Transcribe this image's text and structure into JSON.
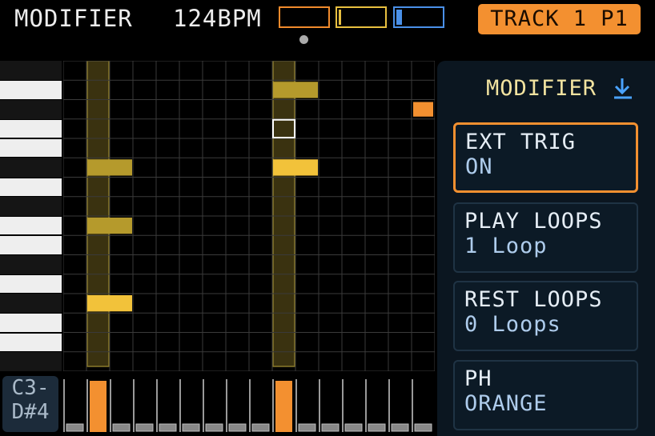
{
  "header": {
    "title": "MODIFIER",
    "bpm": "124BPM",
    "track": "TRACK 1 P1"
  },
  "meters": [
    {
      "color": "#f08a2c",
      "level": 0
    },
    {
      "color": "#e8c040",
      "level": 0.05
    },
    {
      "color": "#4a90e8",
      "level": 0.12
    }
  ],
  "range": {
    "low": "C3-",
    "high": "D#4"
  },
  "panel": {
    "title": "MODIFIER",
    "icon": "download-arrow-icon",
    "params": [
      {
        "name": "EXT TRIG",
        "value": "ON",
        "selected": true
      },
      {
        "name": "PLAY LOOPS",
        "value": "1 Loop",
        "selected": false
      },
      {
        "name": "REST LOOPS",
        "value": "0 Loops",
        "selected": false
      },
      {
        "name": "PH",
        "value": "ORANGE",
        "selected": false
      }
    ]
  },
  "colors": {
    "accent": "#f39030",
    "note": "#f2c23a",
    "note_dim": "#b59a2c",
    "highlight_col": "#3a3210",
    "grid_line": "#3a3a3a"
  },
  "sequencer": {
    "steps": 16,
    "rows": 16,
    "highlighted_steps": [
      1,
      9
    ],
    "notes": [
      {
        "step": 1,
        "row": 5,
        "length": 2,
        "bright": false
      },
      {
        "step": 1,
        "row": 8,
        "length": 2,
        "bright": false
      },
      {
        "step": 1,
        "row": 12,
        "length": 2,
        "bright": true
      },
      {
        "step": 9,
        "row": 1,
        "length": 2,
        "bright": false
      },
      {
        "step": 9,
        "row": 5,
        "length": 2,
        "bright": true
      }
    ],
    "cursor": {
      "step": 9,
      "row": 3
    },
    "marker": {
      "step": 15,
      "row": 2
    },
    "step_bars": [
      {
        "step": 1,
        "active": true
      },
      {
        "step": 9,
        "active": true
      }
    ]
  }
}
